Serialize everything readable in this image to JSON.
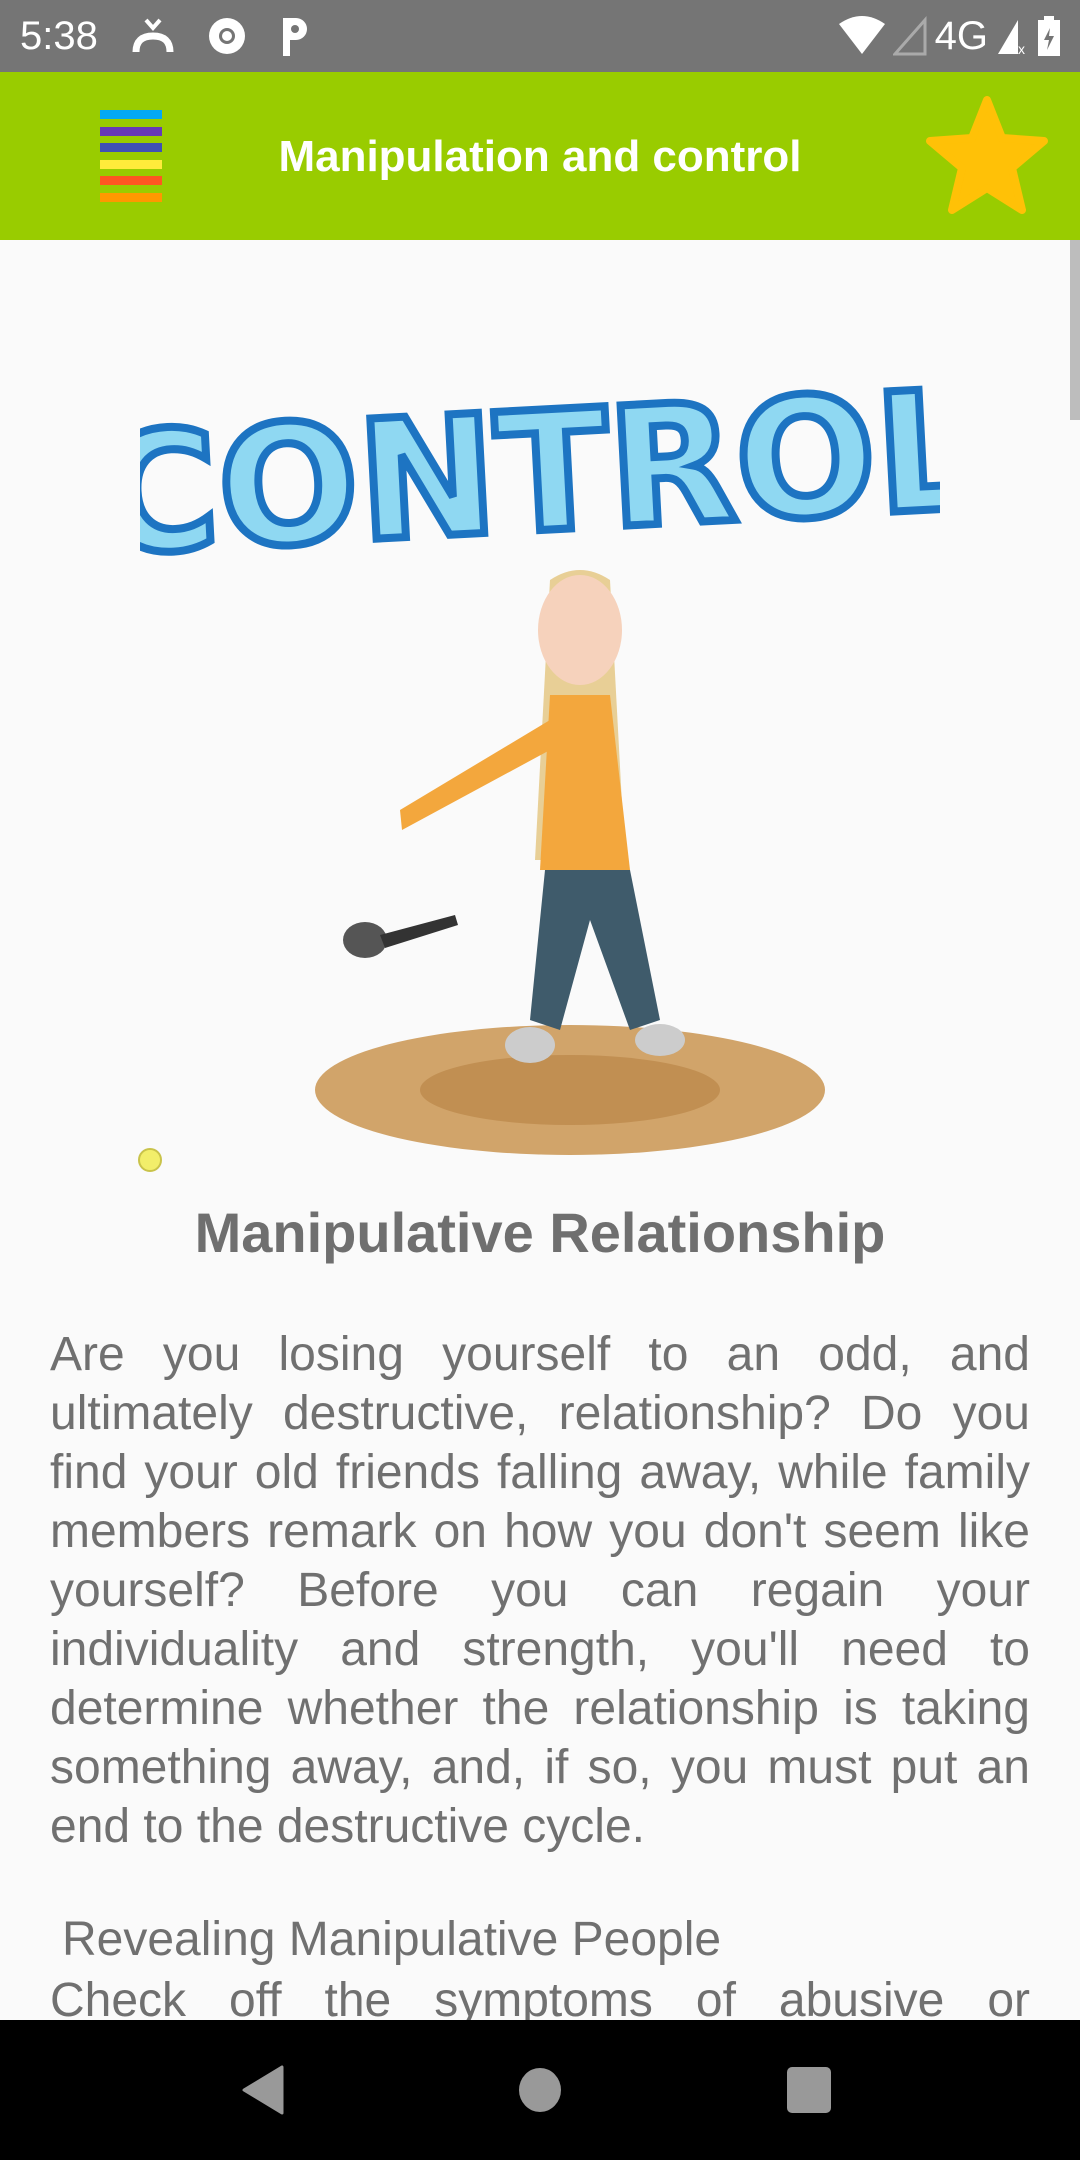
{
  "status_bar": {
    "time": "5:38",
    "network": "4G",
    "icons": [
      "missed-call-icon",
      "chrome-icon",
      "parking-icon",
      "wifi-icon",
      "signal-icon",
      "battery-charging-icon"
    ]
  },
  "header": {
    "title": "Manipulation and control",
    "menu_colors": [
      "#03a9f4",
      "#673ab7",
      "#3f51b5",
      "#ffeb3b",
      "#ff5722",
      "#ff9800"
    ],
    "background": "#99cc00",
    "star_color": "#ffc107"
  },
  "hero": {
    "word": "CONTROL"
  },
  "article": {
    "heading": "Manipulative Relationship",
    "paragraph": "Are you losing yourself to an odd, and ultimately destructive, relationship? Do you find your old friends falling away, while family members remark on how you don't seem like yourself? Before you can regain your individuality and strength, you'll need to determine whether the relationship is taking something away, and, if so, you must put an end to the destructive cycle.",
    "subheading": "Revealing Manipulative People",
    "paragraph2": "Check off the symptoms of abusive or"
  },
  "nav": {
    "back": "back",
    "home": "home",
    "recents": "recents"
  }
}
